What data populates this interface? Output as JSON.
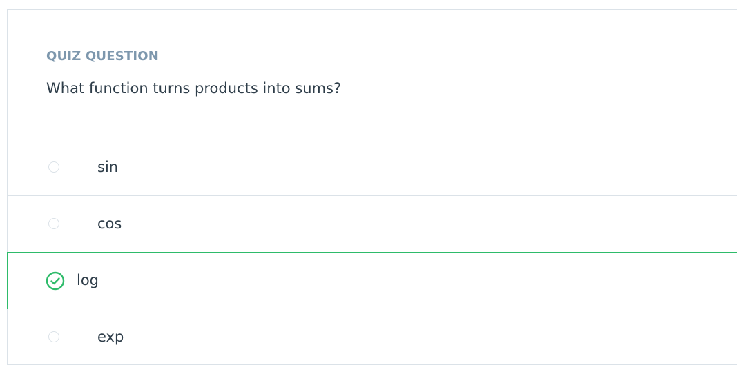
{
  "quiz": {
    "eyebrow": "QUIZ QUESTION",
    "question": "What function turns products into sums?"
  },
  "options": [
    {
      "label": "sin",
      "state": "unselected",
      "icon": "radio-empty-icon"
    },
    {
      "label": "cos",
      "state": "unselected",
      "icon": "radio-empty-icon"
    },
    {
      "label": "log",
      "state": "correct",
      "icon": "check-circle-icon"
    },
    {
      "label": "exp",
      "state": "unselected",
      "icon": "radio-empty-icon"
    }
  ],
  "colors": {
    "correct": "#2ebb6a",
    "eyebrow": "#7d97ad",
    "text": "#2e3d49",
    "border": "#dbe2e8"
  }
}
